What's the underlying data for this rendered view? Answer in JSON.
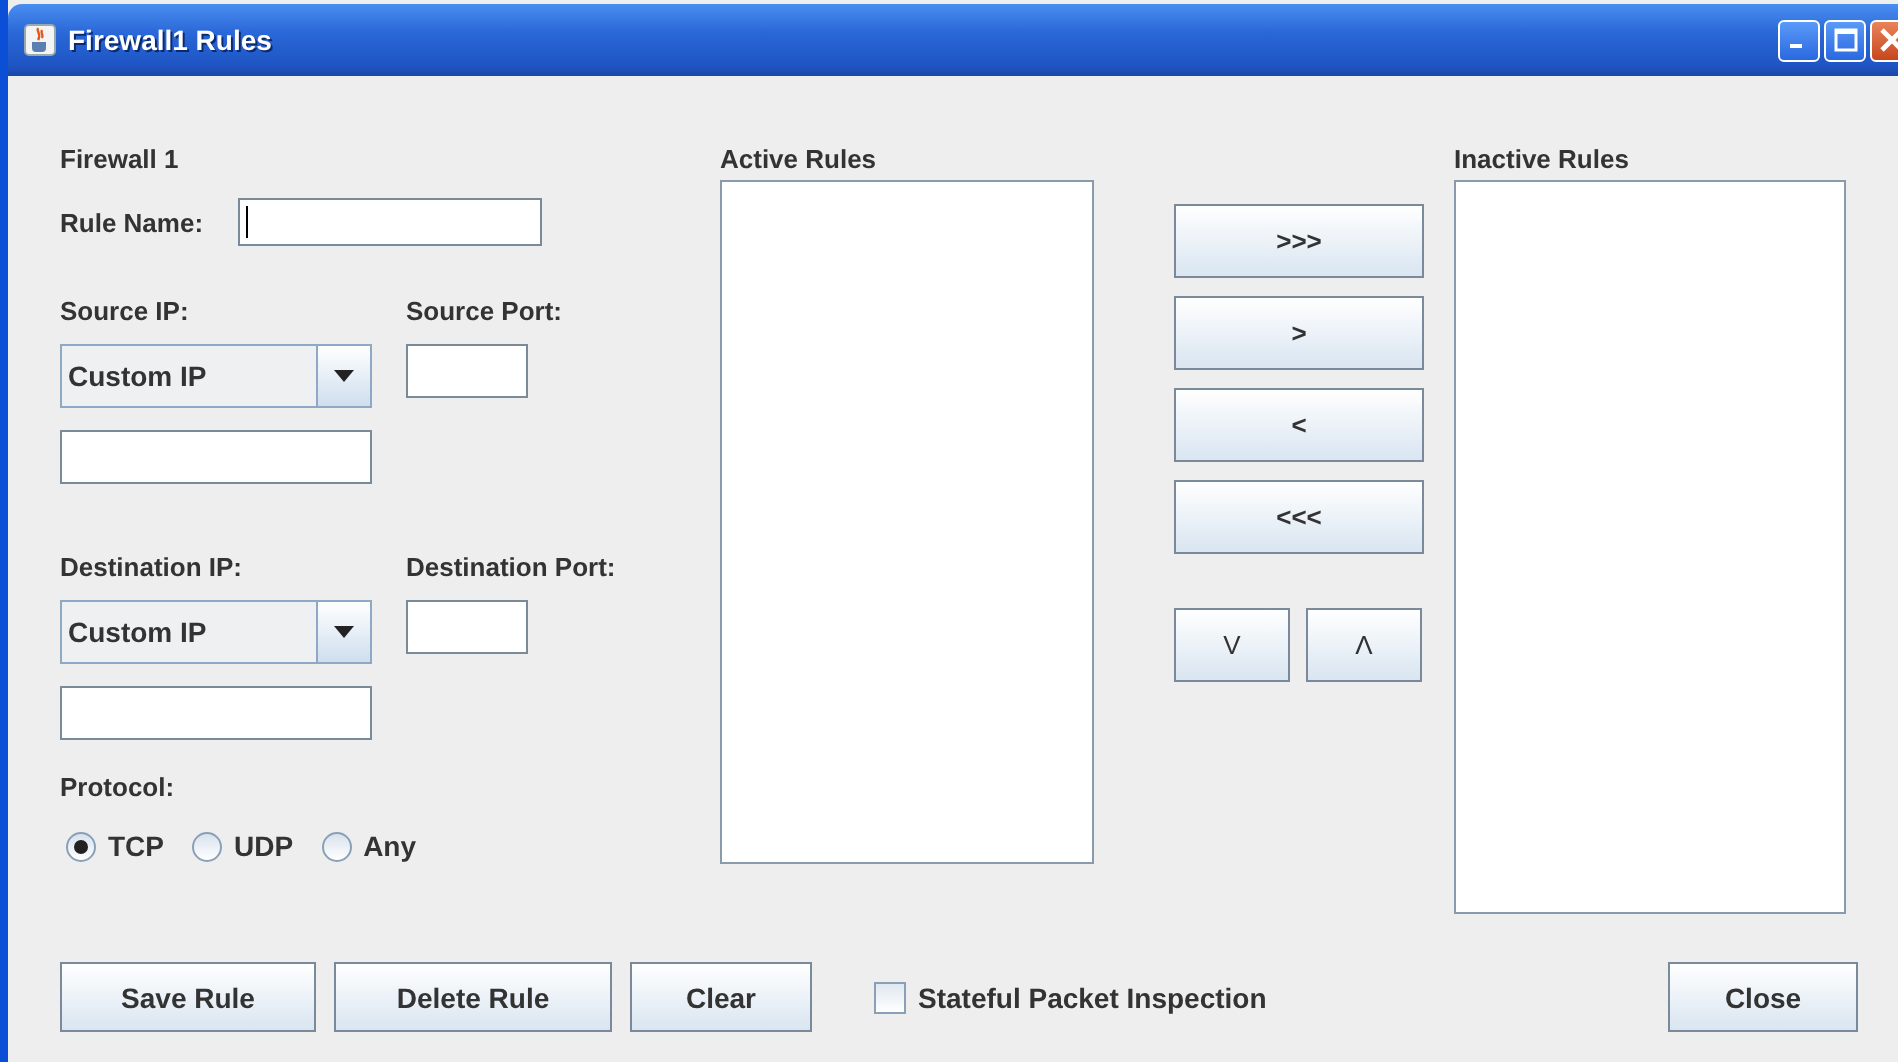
{
  "window": {
    "title": "Firewall1 Rules"
  },
  "firewall_label": "Firewall 1",
  "rule_name": {
    "label": "Rule Name:"
  },
  "source": {
    "ip_label": "Source IP:",
    "port_label": "Source Port:",
    "ip_mode": "Custom IP"
  },
  "destination": {
    "ip_label": "Destination IP:",
    "port_label": "Destination Port:",
    "ip_mode": "Custom IP"
  },
  "protocol": {
    "label": "Protocol:",
    "options": [
      {
        "label": "TCP",
        "selected": true
      },
      {
        "label": "UDP",
        "selected": false
      },
      {
        "label": "Any",
        "selected": false
      }
    ]
  },
  "active_rules": {
    "label": "Active Rules"
  },
  "move_buttons": [
    ">>>",
    ">",
    "<",
    "<<<"
  ],
  "order_buttons": [
    "V",
    "Λ"
  ],
  "inactive_rules": {
    "label": "Inactive Rules"
  },
  "actions": [
    "Save Rule",
    "Delete Rule",
    "Clear"
  ],
  "stateful": {
    "label": "Stateful Packet Inspection",
    "checked": false
  },
  "close_button": "Close"
}
